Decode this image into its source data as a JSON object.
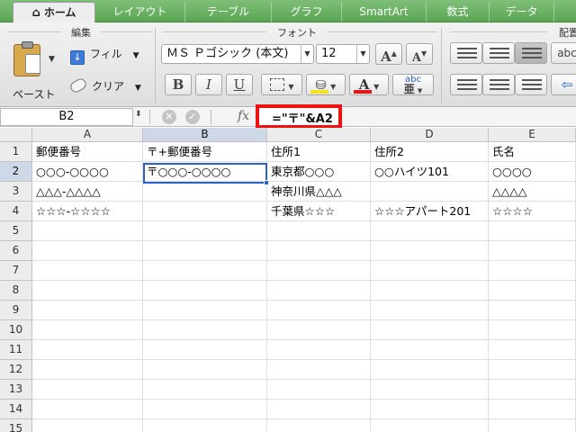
{
  "tabs": [
    {
      "label": "ホーム",
      "active": true
    },
    {
      "label": "レイアウト"
    },
    {
      "label": "テーブル"
    },
    {
      "label": "グラフ"
    },
    {
      "label": "SmartArt"
    },
    {
      "label": "数式"
    },
    {
      "label": "データ"
    }
  ],
  "ribbon": {
    "edit_group_label": "編集",
    "font_group_label": "フォント",
    "align_group_label": "配置",
    "paste_label": "ペースト",
    "fill_label": "フィル",
    "clear_label": "クリア",
    "font_name": "ＭＳ Ｐゴシック (本文)",
    "font_size": "12",
    "grow_font_glyph": "A",
    "shrink_font_glyph": "A",
    "bold_glyph": "B",
    "italic_glyph": "I",
    "underline_glyph": "U",
    "font_color_glyph": "A",
    "phonetic_glyph": "abc",
    "wrap_glyph": "abc",
    "accent_colors": {
      "highlight": "#f5e21b",
      "font_color": "#e8141b"
    }
  },
  "formula_bar": {
    "name_box": "B2",
    "cancel_glyph": "✕",
    "enter_glyph": "✓",
    "fx_label": "fx",
    "formula": "=\"〒\"&A2"
  },
  "grid": {
    "columns": [
      "A",
      "B",
      "C",
      "D",
      "E"
    ],
    "active_column": "B",
    "active_row": "2",
    "rows": [
      {
        "num": "1",
        "cells": [
          "郵便番号",
          "〒+郵便番号",
          "住所1",
          "住所2",
          "氏名"
        ]
      },
      {
        "num": "2",
        "cells": [
          "○○○-○○○○",
          "〒○○○-○○○○",
          "東京都○○○",
          "○○ハイツ101",
          "○○○○"
        ]
      },
      {
        "num": "3",
        "cells": [
          "△△△-△△△△",
          "",
          "神奈川県△△△",
          "",
          "△△△△"
        ]
      },
      {
        "num": "4",
        "cells": [
          "☆☆☆-☆☆☆☆",
          "",
          "千葉県☆☆☆",
          "☆☆☆アパート201",
          "☆☆☆☆"
        ]
      },
      {
        "num": "5",
        "cells": [
          "",
          "",
          "",
          "",
          ""
        ]
      },
      {
        "num": "6",
        "cells": [
          "",
          "",
          "",
          "",
          ""
        ]
      },
      {
        "num": "7",
        "cells": [
          "",
          "",
          "",
          "",
          ""
        ]
      },
      {
        "num": "8",
        "cells": [
          "",
          "",
          "",
          "",
          ""
        ]
      },
      {
        "num": "9",
        "cells": [
          "",
          "",
          "",
          "",
          ""
        ]
      },
      {
        "num": "10",
        "cells": [
          "",
          "",
          "",
          "",
          ""
        ]
      },
      {
        "num": "11",
        "cells": [
          "",
          "",
          "",
          "",
          ""
        ]
      },
      {
        "num": "12",
        "cells": [
          "",
          "",
          "",
          "",
          ""
        ]
      },
      {
        "num": "13",
        "cells": [
          "",
          "",
          "",
          "",
          ""
        ]
      },
      {
        "num": "14",
        "cells": [
          "",
          "",
          "",
          "",
          ""
        ]
      },
      {
        "num": "15",
        "cells": [
          "",
          "",
          "",
          "",
          ""
        ]
      }
    ]
  }
}
